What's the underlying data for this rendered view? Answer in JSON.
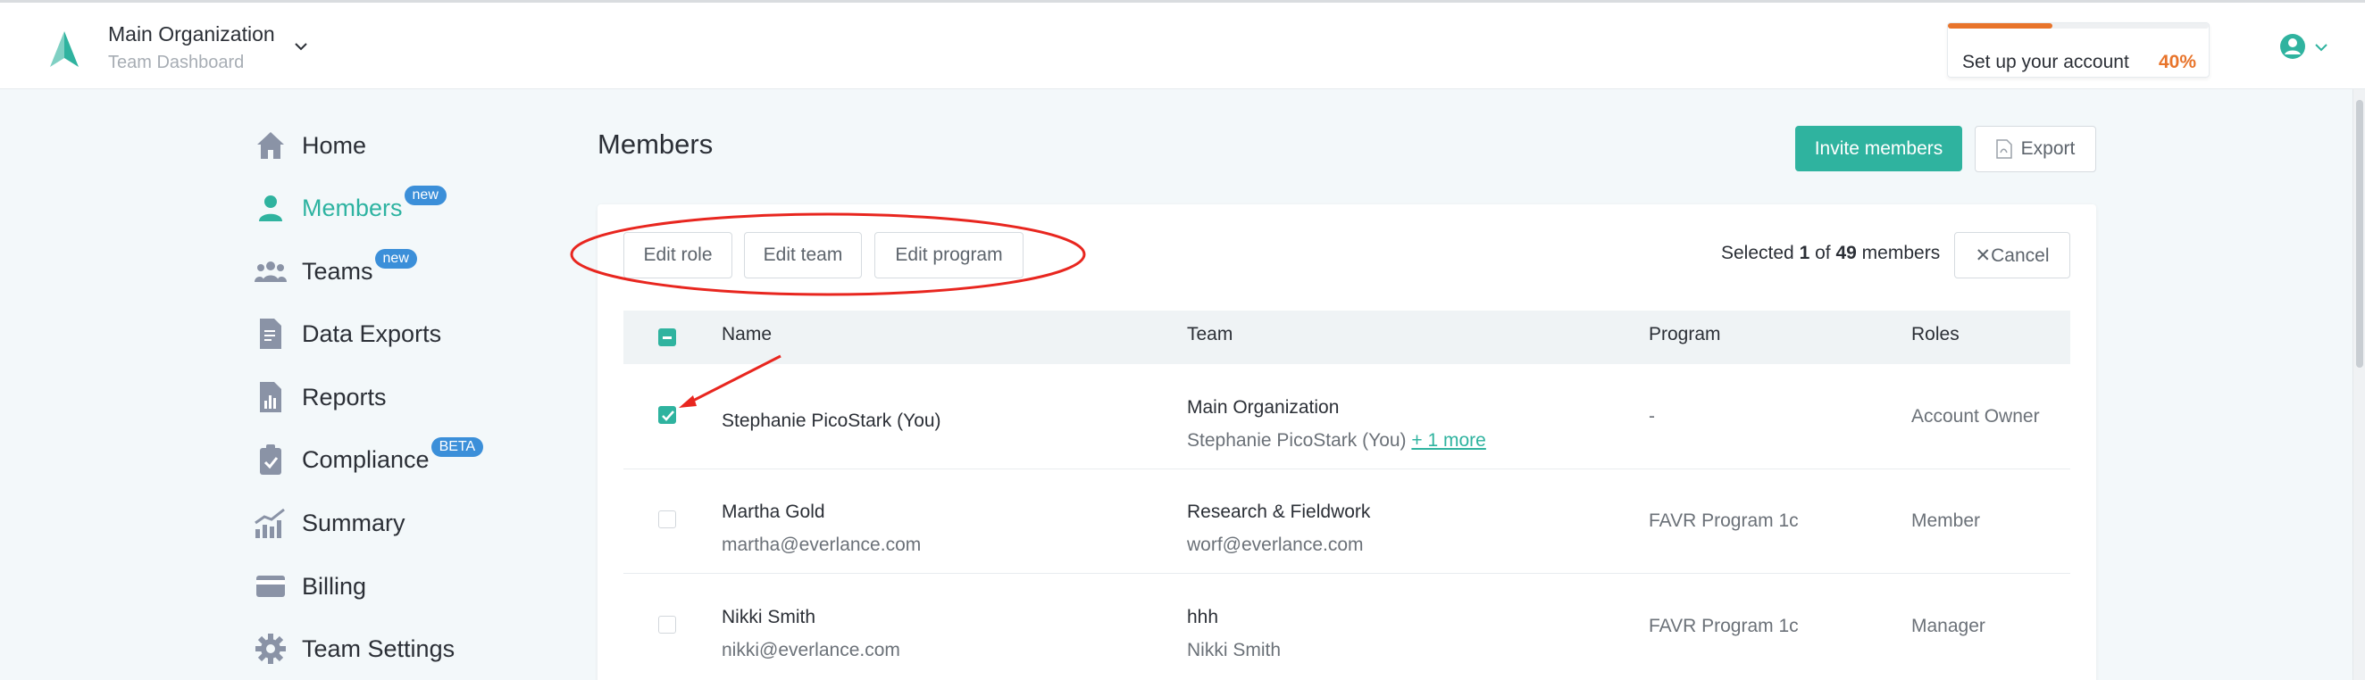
{
  "header": {
    "org_name": "Main Organization",
    "org_subtitle": "Team Dashboard",
    "setup_label": "Set up your account",
    "setup_percent_text": "40%",
    "setup_progress": 0.4,
    "accent": "#2fb39f",
    "progress_color": "#e8742b"
  },
  "sidebar": {
    "items": [
      {
        "label": "Home",
        "icon": "home-icon"
      },
      {
        "label": "Members",
        "icon": "user-icon",
        "badge": "new",
        "active": true
      },
      {
        "label": "Teams",
        "icon": "users-icon",
        "badge": "new"
      },
      {
        "label": "Data Exports",
        "icon": "document-export-icon"
      },
      {
        "label": "Reports",
        "icon": "bar-chart-icon"
      },
      {
        "label": "Compliance",
        "icon": "clipboard-check-icon",
        "badge": "BETA"
      },
      {
        "label": "Summary",
        "icon": "trend-chart-icon"
      },
      {
        "label": "Billing",
        "icon": "credit-card-icon"
      },
      {
        "label": "Team Settings",
        "icon": "gear-icon"
      }
    ],
    "badge_color": "#3b8fd9"
  },
  "main": {
    "title": "Members",
    "invite_label": "Invite members",
    "export_label": "Export",
    "toolbar": {
      "edit_role": "Edit role",
      "edit_team": "Edit team",
      "edit_program": "Edit program"
    },
    "selection": {
      "prefix": "Selected",
      "count": "1",
      "of": "of",
      "total": "49",
      "suffix": "members",
      "cancel_label": "Cancel"
    },
    "table": {
      "headers": [
        "Name",
        "Team",
        "Program",
        "Roles"
      ],
      "rows": [
        {
          "name": "Stephanie PicoStark (You)",
          "email": "",
          "team": "Main Organization",
          "team_sub": "Stephanie PicoStark (You)",
          "team_more": "+ 1 more",
          "program": "-",
          "role": "Account Owner",
          "checked": true
        },
        {
          "name": "Martha Gold",
          "email": "martha@everlance.com",
          "team": "Research & Fieldwork",
          "team_sub": "worf@everlance.com",
          "team_more": "",
          "program": "FAVR Program 1c",
          "role": "Member",
          "checked": false
        },
        {
          "name": "Nikki Smith",
          "email": "nikki@everlance.com",
          "team": "hhh",
          "team_sub": "Nikki Smith",
          "team_more": "",
          "program": "FAVR Program 1c",
          "role": "Manager",
          "checked": false
        }
      ]
    }
  }
}
